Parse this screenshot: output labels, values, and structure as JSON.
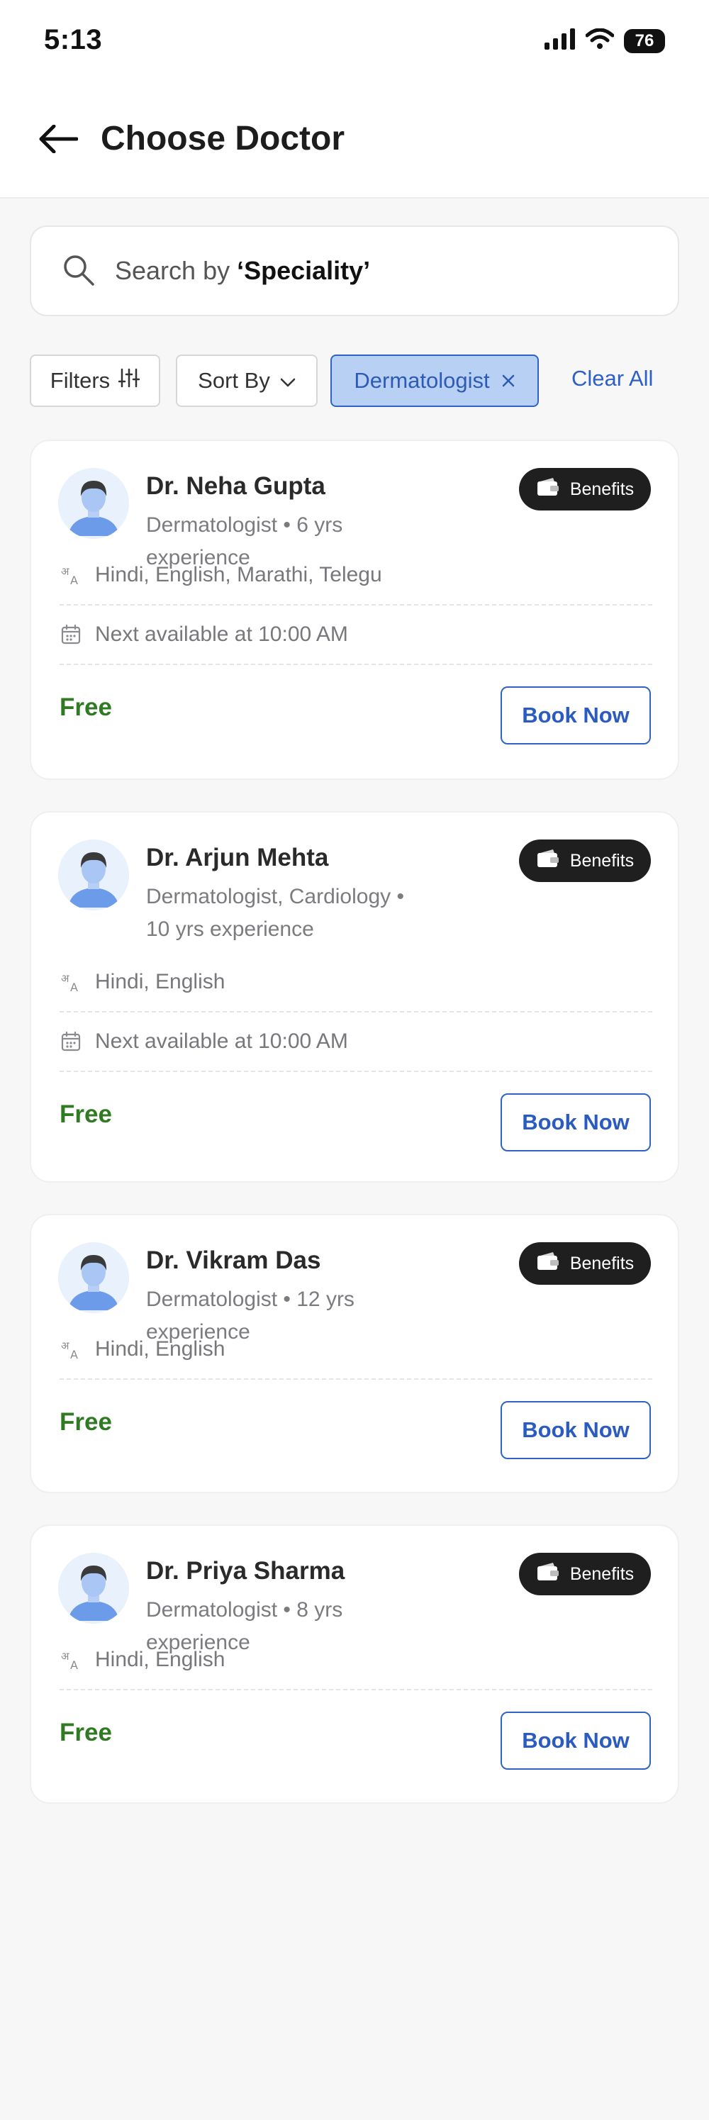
{
  "status_bar": {
    "time": "5:13",
    "battery": "76"
  },
  "header": {
    "title": "Choose Doctor"
  },
  "search": {
    "prefix": "Search by ",
    "keyword": "‘Speciality’"
  },
  "filters": {
    "filters_label": "Filters",
    "sort_label": "Sort By",
    "active_filter": "Dermatologist",
    "clear_all": "Clear All"
  },
  "doctors": [
    {
      "name": "Dr. Neha Gupta",
      "speciality_line1": "Dermatologist • 6 yrs experience",
      "speciality_line2": "",
      "languages": "Hindi, English, Marathi, Telegu",
      "availability": "Next available at 10:00 AM",
      "price": "Free",
      "benefits_label": "Benefits",
      "book_label": "Book Now"
    },
    {
      "name": "Dr. Arjun Mehta",
      "speciality_line1": "Dermatologist, Cardiology •",
      "speciality_line2": "10 yrs experience",
      "languages": "Hindi, English",
      "availability": "Next available at 10:00 AM",
      "price": "Free",
      "benefits_label": "Benefits",
      "book_label": "Book Now"
    },
    {
      "name": "Dr. Vikram Das",
      "speciality_line1": "Dermatologist • 12 yrs experience",
      "speciality_line2": "",
      "languages": "Hindi, English",
      "availability": "",
      "price": "Free",
      "benefits_label": "Benefits",
      "book_label": "Book Now"
    },
    {
      "name": "Dr. Priya Sharma",
      "speciality_line1": "Dermatologist • 8 yrs experience",
      "speciality_line2": "",
      "languages": "Hindi, English",
      "availability": "",
      "price": "Free",
      "benefits_label": "Benefits",
      "book_label": "Book Now"
    }
  ],
  "colors": {
    "accent_blue": "#2f64c6",
    "chip_active_bg": "#b9d0f5",
    "price_green": "#2f7a22",
    "benefits_bg": "#1f1f1f"
  }
}
